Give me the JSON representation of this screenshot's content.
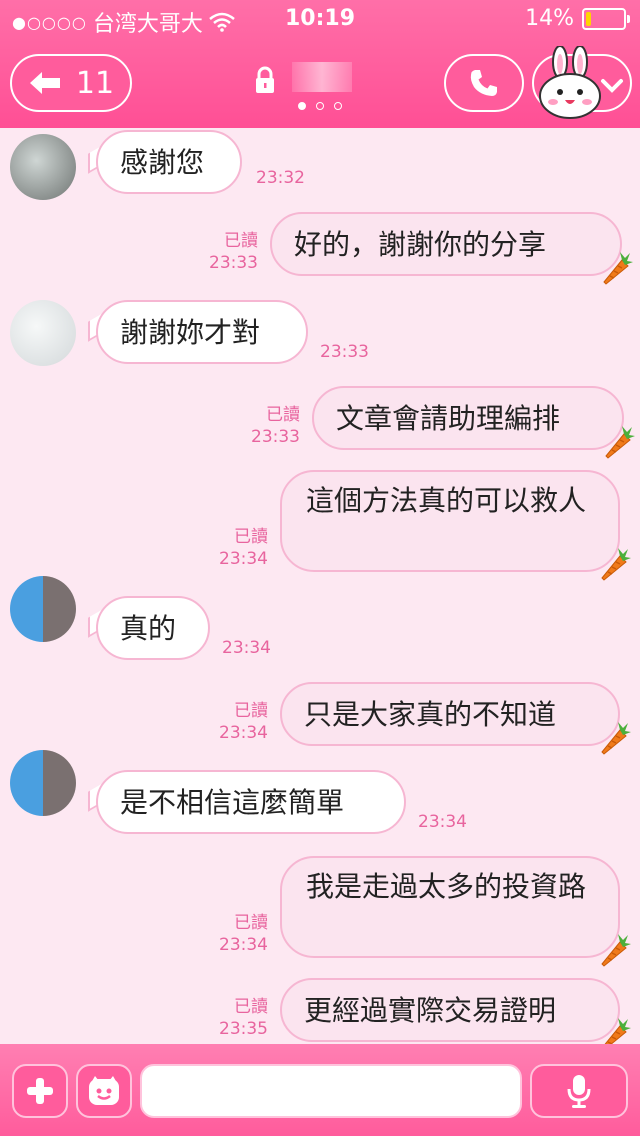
{
  "status_bar": {
    "signal_dots": "●○○○○",
    "carrier": "台湾大哥大",
    "time": "10:19",
    "battery": "14%",
    "battery_level": 0.14
  },
  "nav": {
    "unread_count": "11",
    "page_indicator_count": 3,
    "page_indicator_active": 0
  },
  "messages": [
    {
      "side": "in",
      "text": "感謝您",
      "time": "23:32"
    },
    {
      "side": "out",
      "text": "好的，謝謝你的分享",
      "read": "已讀",
      "time": "23:33"
    },
    {
      "side": "in",
      "text": "謝謝妳才對",
      "time": "23:33"
    },
    {
      "side": "out",
      "text": "文章會請助理編排",
      "read": "已讀",
      "time": "23:33"
    },
    {
      "side": "out",
      "text": "這個方法真的可以救人",
      "read": "已讀",
      "time": "23:34"
    },
    {
      "side": "in",
      "text": "真的",
      "time": "23:34"
    },
    {
      "side": "out",
      "text": "只是大家真的不知道",
      "read": "已讀",
      "time": "23:34"
    },
    {
      "side": "in",
      "text": "是不相信這麼簡單",
      "time": "23:34"
    },
    {
      "side": "out",
      "text": "我是走過太多的投資路",
      "read": "已讀",
      "time": "23:34"
    },
    {
      "side": "out",
      "text": "更經過實際交易證明",
      "read": "已讀",
      "time": "23:35"
    }
  ],
  "input": {
    "placeholder": ""
  },
  "colors": {
    "header": "#ff5c9c",
    "accent_text": "#e8649e",
    "bubble_border": "#f6b6d2",
    "background": "#fde8f2"
  }
}
